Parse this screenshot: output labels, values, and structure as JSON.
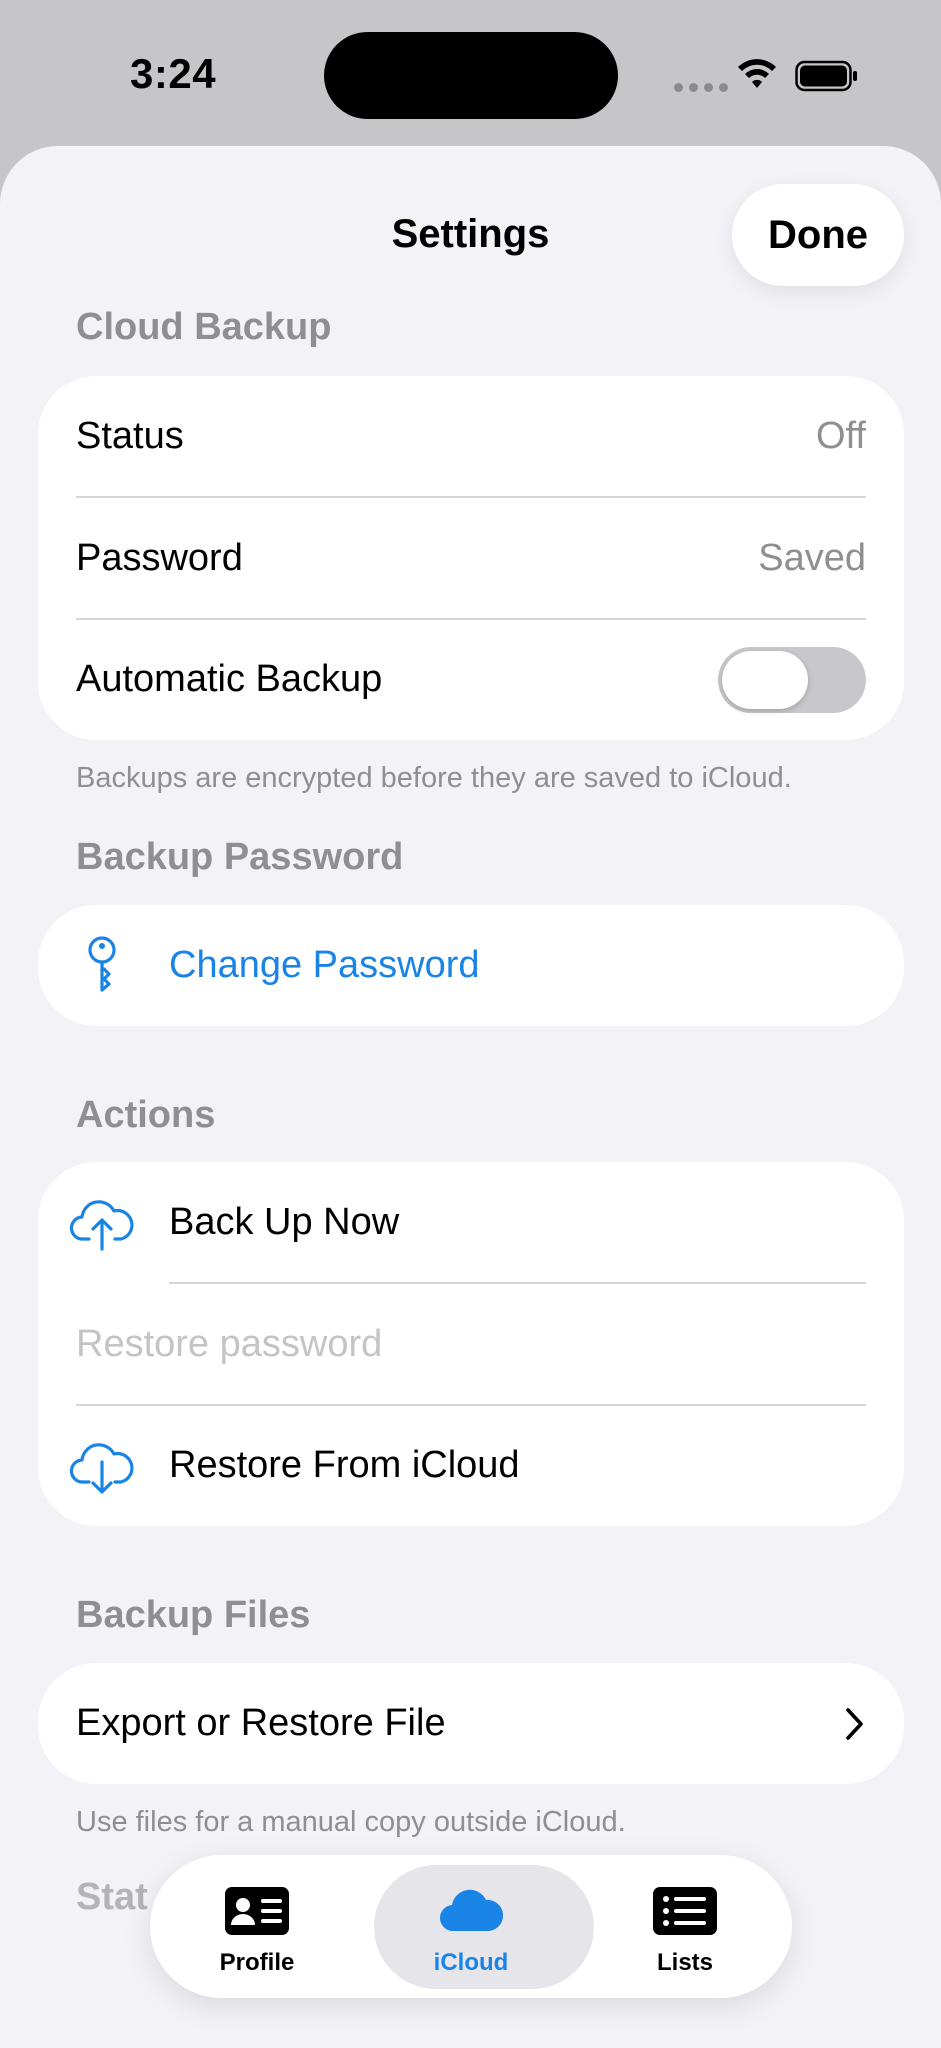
{
  "status_bar": {
    "time": "3:24"
  },
  "nav": {
    "title": "Settings",
    "done_label": "Done"
  },
  "cloud_backup": {
    "header": "Cloud Backup",
    "rows": [
      {
        "label": "Status",
        "value": "Off"
      },
      {
        "label": "Password",
        "value": "Saved"
      },
      {
        "label": "Automatic Backup",
        "toggle": false
      }
    ],
    "footer": "Backups are encrypted before they are saved to iCloud."
  },
  "backup_password": {
    "header": "Backup Password",
    "change_label": "Change Password"
  },
  "actions": {
    "header": "Actions",
    "back_up_label": "Back Up Now",
    "restore_placeholder": "Restore password",
    "restore_label": "Restore From iCloud"
  },
  "backup_files": {
    "header": "Backup Files",
    "export_label": "Export or Restore File",
    "footer": "Use files for a manual copy outside iCloud."
  },
  "partial_section": {
    "header": "Stat"
  },
  "tabs": [
    {
      "label": "Profile",
      "icon": "profile-card-icon",
      "active": false
    },
    {
      "label": "iCloud",
      "icon": "cloud-icon",
      "active": true
    },
    {
      "label": "Lists",
      "icon": "list-icon",
      "active": false
    }
  ],
  "colors": {
    "accent": "#1a84e6",
    "background": "#f2f2f7",
    "secondary_text": "#8e8e93"
  }
}
